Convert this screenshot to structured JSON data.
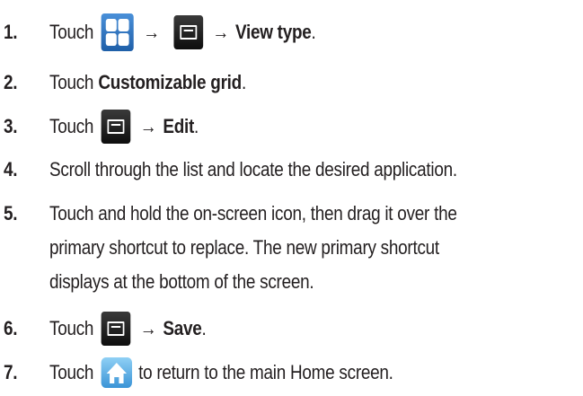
{
  "steps": [
    {
      "number": "1.",
      "touch": "Touch",
      "arrow": "→",
      "bold": "View type",
      "end": "."
    },
    {
      "number": "2.",
      "touch": "Touch",
      "bold": "Customizable grid",
      "end": "."
    },
    {
      "number": "3.",
      "touch": "Touch",
      "arrow": "→",
      "bold": "Edit",
      "end": "."
    },
    {
      "number": "4.",
      "text": "Scroll through the list and locate the desired application."
    },
    {
      "number": "5.",
      "lines": [
        "Touch and hold the on-screen icon, then drag it over the",
        "primary shortcut to replace. The new primary shortcut",
        "displays at the bottom of the screen."
      ]
    },
    {
      "number": "6.",
      "touch": "Touch",
      "arrow": "→",
      "bold": "Save",
      "end": "."
    },
    {
      "number": "7.",
      "touch": "Touch",
      "text": "to return to the main Home screen."
    }
  ],
  "icons": {
    "apps": "apps-grid-icon",
    "menu": "menu-icon",
    "home": "home-icon"
  },
  "colors": {
    "text": "#231f20",
    "apps_icon": "#2f74c0",
    "menu_icon": "#1a1a1a",
    "home_icon": "#5fb3e8"
  }
}
